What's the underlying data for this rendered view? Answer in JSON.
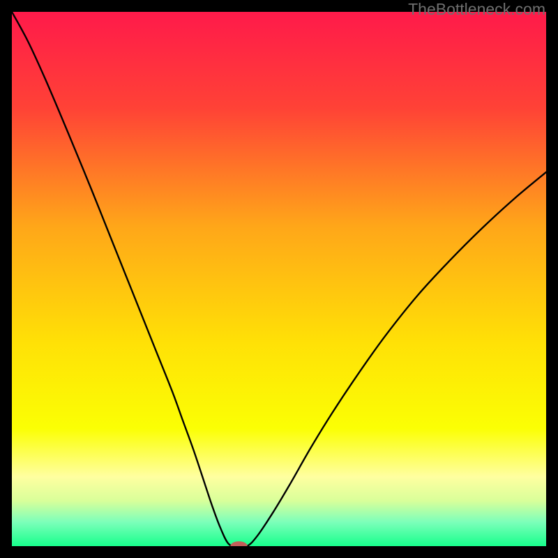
{
  "watermark": "TheBottleneck.com",
  "chart_data": {
    "type": "line",
    "title": "",
    "xlabel": "",
    "ylabel": "",
    "xlim": [
      0,
      100
    ],
    "ylim": [
      0,
      100
    ],
    "grid": false,
    "legend": false,
    "background": {
      "style": "vertical-gradient",
      "stops": [
        {
          "offset": 0.0,
          "color": "#ff1a4a"
        },
        {
          "offset": 0.18,
          "color": "#ff4236"
        },
        {
          "offset": 0.4,
          "color": "#ffa619"
        },
        {
          "offset": 0.62,
          "color": "#ffe106"
        },
        {
          "offset": 0.78,
          "color": "#fbff04"
        },
        {
          "offset": 0.87,
          "color": "#ffffa0"
        },
        {
          "offset": 0.915,
          "color": "#d9ff9a"
        },
        {
          "offset": 0.955,
          "color": "#7cffba"
        },
        {
          "offset": 1.0,
          "color": "#17ff8c"
        }
      ]
    },
    "series": [
      {
        "name": "bottleneck-curve",
        "color": "#000000",
        "x": [
          0.0,
          3.0,
          6.0,
          9.0,
          12.0,
          15.0,
          18.0,
          21.0,
          24.0,
          27.0,
          30.0,
          32.0,
          34.0,
          36.0,
          37.5,
          39.0,
          40.5,
          42.0,
          44.0,
          46.0,
          49.0,
          52.0,
          56.0,
          60.0,
          65.0,
          70.0,
          76.0,
          82.0,
          88.0,
          94.0,
          100.0
        ],
        "y": [
          100.0,
          94.5,
          88.0,
          81.0,
          73.8,
          66.5,
          59.0,
          51.5,
          44.0,
          36.5,
          29.0,
          23.5,
          18.0,
          12.0,
          7.5,
          3.5,
          0.5,
          0.0,
          0.0,
          2.0,
          6.5,
          11.5,
          18.5,
          25.0,
          32.5,
          39.5,
          47.0,
          53.5,
          59.5,
          65.0,
          70.0
        ]
      }
    ],
    "marker": {
      "name": "optimal-point",
      "cx": 42.5,
      "cy": 0.0,
      "rx": 1.6,
      "ry": 0.9,
      "fill": "#c35f5a"
    }
  }
}
